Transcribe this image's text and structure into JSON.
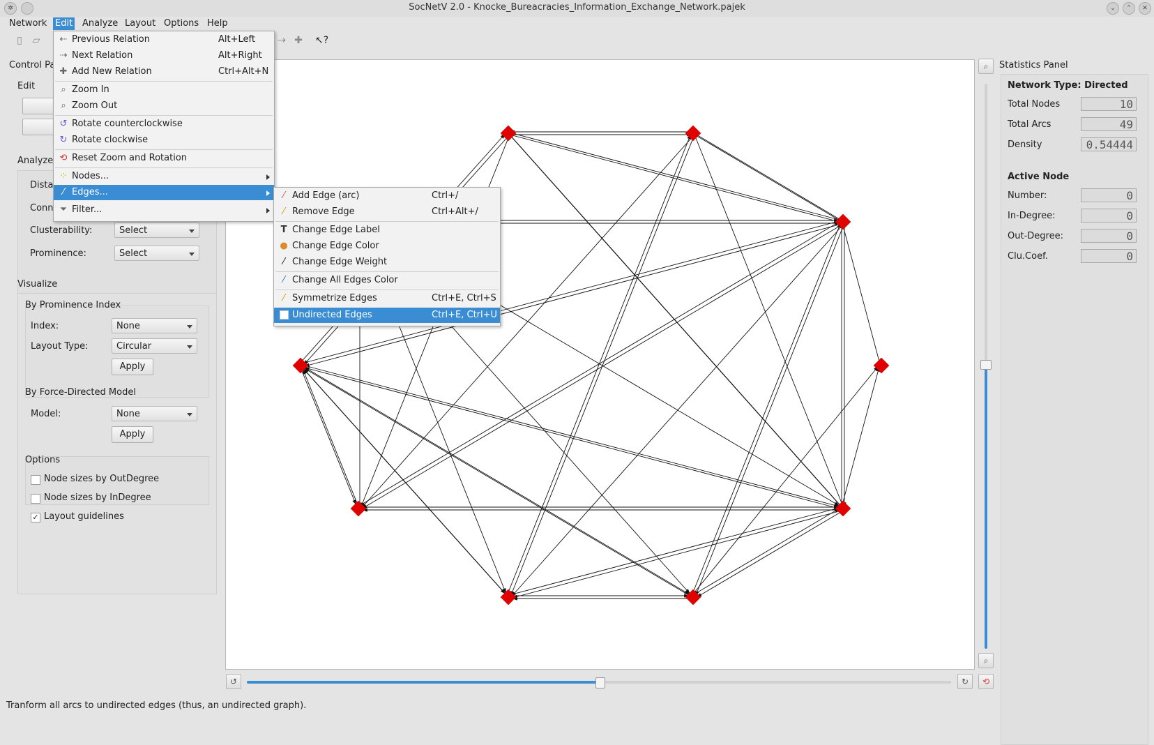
{
  "window": {
    "title": "SocNetV 2.0 - Knocke_Bureacracies_Information_Exchange_Network.pajek"
  },
  "menubar": [
    "Network",
    "Edit",
    "Analyze",
    "Layout",
    "Options",
    "Help"
  ],
  "control_panel": {
    "title": "Control Pa",
    "edit_label": "Edit",
    "analyze_label": "Analyze",
    "distance_label": "Dista",
    "connectivity_label": "Conn",
    "clusterability_label": "Clusterability:",
    "clusterability_value": "Select",
    "prominence_label": "Prominence:",
    "prominence_value": "Select",
    "visualize_label": "Visualize",
    "by_prominence": "By Prominence Index",
    "index_label": "Index:",
    "index_value": "None",
    "layout_type_label": "Layout Type:",
    "layout_type_value": "Circular",
    "apply_label": "Apply",
    "by_force": "By Force-Directed Model",
    "model_label": "Model:",
    "model_value": "None",
    "apply2_label": "Apply",
    "options_label": "Options",
    "opt_outdegree": "Node sizes by OutDegree",
    "opt_indegree": "Node sizes by InDegree",
    "opt_guidelines": "Layout guidelines",
    "opt_outdegree_checked": false,
    "opt_indegree_checked": false,
    "opt_guidelines_checked": true
  },
  "edit_menu": {
    "items": [
      {
        "label": "Previous Relation",
        "shortcut": "Alt+Left",
        "icon": "arrow-left-icon"
      },
      {
        "label": "Next Relation",
        "shortcut": "Alt+Right",
        "icon": "arrow-right-icon"
      },
      {
        "label": "Add New Relation",
        "shortcut": "Ctrl+Alt+N",
        "icon": "plus-icon"
      },
      {
        "label": "Zoom In",
        "shortcut": "",
        "icon": "zoom-in-icon"
      },
      {
        "label": "Zoom Out",
        "shortcut": "",
        "icon": "zoom-out-icon"
      },
      {
        "label": "Rotate counterclockwise",
        "shortcut": "",
        "icon": "rotate-ccw-icon"
      },
      {
        "label": "Rotate clockwise",
        "shortcut": "",
        "icon": "rotate-cw-icon"
      },
      {
        "label": "Reset Zoom and Rotation",
        "shortcut": "",
        "icon": "reset-icon"
      },
      {
        "label": "Nodes...",
        "shortcut": "",
        "icon": "nodes-icon"
      },
      {
        "label": "Edges...",
        "shortcut": "",
        "icon": "edges-icon"
      },
      {
        "label": "Filter...",
        "shortcut": "",
        "icon": "filter-icon"
      }
    ]
  },
  "edges_menu": {
    "items": [
      {
        "label": "Add Edge (arc)",
        "shortcut": "Ctrl+/",
        "icon": "add-edge-icon"
      },
      {
        "label": "Remove Edge",
        "shortcut": "Ctrl+Alt+/",
        "icon": "remove-edge-icon"
      },
      {
        "label": "Change Edge Label",
        "shortcut": "",
        "icon": "text-icon"
      },
      {
        "label": "Change Edge Color",
        "shortcut": "",
        "icon": "palette-icon"
      },
      {
        "label": "Change Edge Weight",
        "shortcut": "",
        "icon": "weight-icon"
      },
      {
        "label": "Change All Edges Color",
        "shortcut": "",
        "icon": "line-color-icon"
      },
      {
        "label": "Symmetrize Edges",
        "shortcut": "Ctrl+E, Ctrl+S",
        "icon": "symmetrize-icon"
      },
      {
        "label": "Undirected Edges",
        "shortcut": "Ctrl+E, Ctrl+U",
        "icon": "checkbox-icon"
      }
    ]
  },
  "stats": {
    "title": "Statistics Panel",
    "network_type": "Network Type: Directed",
    "total_nodes_label": "Total Nodes",
    "total_nodes": "10",
    "total_arcs_label": "Total Arcs",
    "total_arcs": "49",
    "density_label": "Density",
    "density": "0.54444",
    "active_node": "Active Node",
    "number_label": "Number:",
    "number": "0",
    "indegree_label": "In-Degree:",
    "indegree": "0",
    "outdegree_label": "Out-Degree:",
    "outdegree": "0",
    "clucoef_label": "Clu.Coef.",
    "clucoef": "0"
  },
  "colors": {
    "accent": "#3a8dd3",
    "node": "#e00000"
  },
  "status": "Tranform all arcs to undirected edges (thus, an undirected graph)."
}
